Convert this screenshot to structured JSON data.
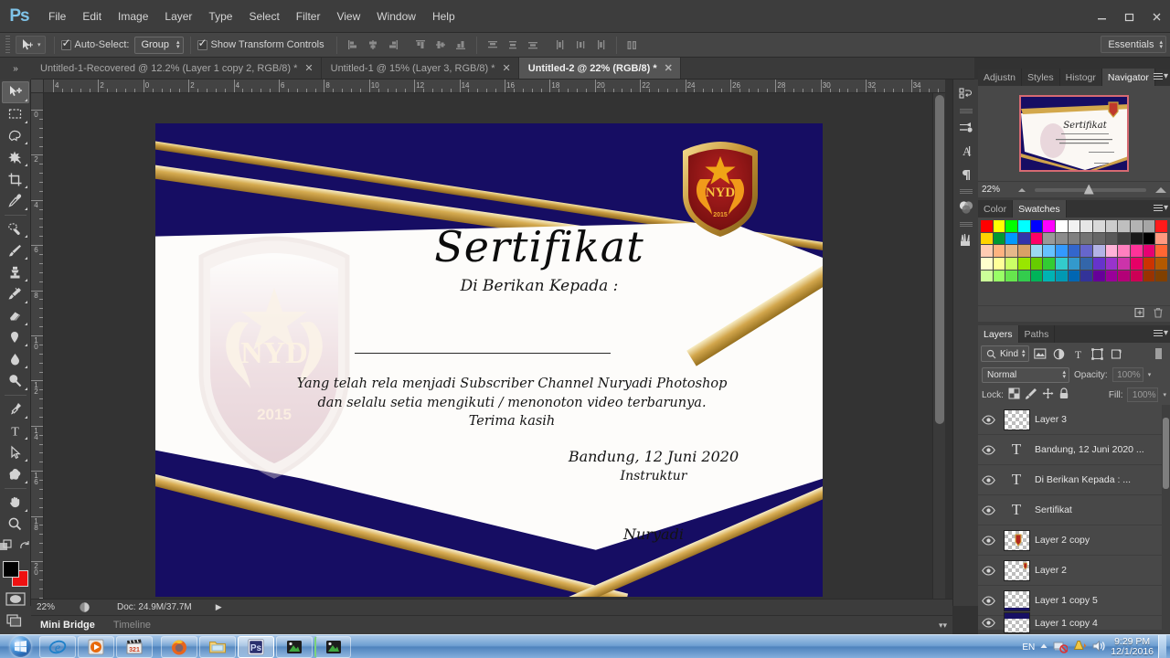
{
  "app": {
    "name": "Adobe Photoshop",
    "logo_text": "Ps"
  },
  "menubar": {
    "items": [
      "File",
      "Edit",
      "Image",
      "Layer",
      "Type",
      "Select",
      "Filter",
      "View",
      "Window",
      "Help"
    ],
    "window_controls": {
      "minimize": "—",
      "restore": "❐",
      "close": "✕"
    }
  },
  "options_bar": {
    "auto_select_label": "Auto-Select:",
    "auto_select_checked": true,
    "auto_select_value": "Group",
    "show_transform_label": "Show Transform Controls",
    "show_transform_checked": true,
    "workspace": "Essentials",
    "align_icons": [
      "align-left-edges",
      "align-horizontal-centers",
      "align-right-edges",
      "align-top-edges",
      "align-vertical-centers",
      "align-bottom-edges",
      "distribute-top-edges",
      "distribute-vertical-centers",
      "distribute-bottom-edges",
      "distribute-left-edges",
      "distribute-horizontal-centers",
      "distribute-right-edges",
      "auto-align-layers"
    ]
  },
  "tabs": [
    {
      "label": "Untitled-1-Recovered @ 12.2% (Layer 1 copy 2, RGB/8) *",
      "active": false
    },
    {
      "label": "Untitled-1 @ 15% (Layer 3, RGB/8) *",
      "active": false
    },
    {
      "label": "Untitled-2 @ 22% (RGB/8) *",
      "active": true
    }
  ],
  "toolbar": {
    "tools": [
      {
        "name": "move-tool",
        "selected": true
      },
      {
        "name": "rectangular-marquee-tool",
        "selected": false
      },
      {
        "name": "lasso-tool",
        "selected": false
      },
      {
        "name": "quick-selection-tool",
        "selected": false
      },
      {
        "name": "crop-tool",
        "selected": false
      },
      {
        "name": "eyedropper-tool",
        "selected": false
      },
      {
        "name": "spot-healing-brush-tool",
        "selected": false
      },
      {
        "name": "brush-tool",
        "selected": false
      },
      {
        "name": "clone-stamp-tool",
        "selected": false
      },
      {
        "name": "history-brush-tool",
        "selected": false
      },
      {
        "name": "eraser-tool",
        "selected": false
      },
      {
        "name": "gradient-tool",
        "selected": false
      },
      {
        "name": "blur-tool",
        "selected": false
      },
      {
        "name": "dodge-tool",
        "selected": false
      },
      {
        "name": "pen-tool",
        "selected": false
      },
      {
        "name": "horizontal-type-tool",
        "selected": false
      },
      {
        "name": "path-selection-tool",
        "selected": false
      },
      {
        "name": "custom-shape-tool",
        "selected": false
      },
      {
        "name": "hand-tool",
        "selected": false
      },
      {
        "name": "zoom-tool",
        "selected": false
      }
    ],
    "foreground_color": "#000000",
    "background_color": "#ee1111"
  },
  "rulers": {
    "unit": "inches",
    "horizontal_labels": [
      "4",
      "2",
      "0",
      "2",
      "4",
      "6",
      "8",
      "10",
      "12",
      "14",
      "16",
      "18",
      "20",
      "22",
      "24",
      "26",
      "28",
      "30",
      "32",
      "34"
    ],
    "vertical_labels": [
      "0",
      "2",
      "4",
      "6",
      "8",
      "10",
      "12",
      "14",
      "16",
      "18",
      "20"
    ]
  },
  "document": {
    "title": "Untitled-2",
    "zoom": "22%",
    "color_mode": "RGB/8",
    "certificate": {
      "title": "Sertifikat",
      "subtitle": "Di Berikan Kepada :",
      "body_lines": [
        "Yang telah rela menjadi Subscriber  Channel Nuryadi Photoshop",
        "dan selalu setia mengikuti  /  menonoton video terbarunya.",
        "Terima kasih"
      ],
      "place_date": "Bandung, 12 Juni 2020",
      "role": "Instruktur",
      "signature": "Nuryadi",
      "emblem_text": "NYD",
      "emblem_year": "2015",
      "navy_color": "#160d63",
      "gold_color": "#d4a84e",
      "paper_color": "#fdfcfa"
    }
  },
  "icon_dock": {
    "icons": [
      "history-icon",
      "tool-presets-icon",
      "character-icon",
      "paragraph-icon",
      "color-balance-icon",
      "brush-presets-icon"
    ]
  },
  "navigator_panel": {
    "tabs": [
      {
        "label": "Adjustn",
        "active": false
      },
      {
        "label": "Styles",
        "active": false
      },
      {
        "label": "Histogr",
        "active": false
      },
      {
        "label": "Navigator",
        "active": true
      }
    ],
    "zoom_value": "22%"
  },
  "color_panel": {
    "tabs": [
      {
        "label": "Color",
        "active": false
      },
      {
        "label": "Swatches",
        "active": true
      }
    ],
    "swatches": [
      "#ff0000",
      "#ffff00",
      "#00ff00",
      "#00ffff",
      "#0000ff",
      "#ff00ff",
      "#ffffff",
      "#f2f2f2",
      "#e6e6e6",
      "#d9d9d9",
      "#cccccc",
      "#bfbfbf",
      "#b3b3b3",
      "#a6a6a6",
      "#ff1a1a",
      "#ffd400",
      "#009933",
      "#0099ff",
      "#3333aa",
      "#ff0066",
      "#999999",
      "#8c8c8c",
      "#808080",
      "#737373",
      "#666666",
      "#595959",
      "#404040",
      "#1a1a1a",
      "#000000",
      "#ff9980",
      "#ffccb3",
      "#ffb380",
      "#e6b88a",
      "#d9a066",
      "#9cd9f0",
      "#66c2ff",
      "#3399ff",
      "#3366cc",
      "#6666cc",
      "#b3b3e6",
      "#ffb3d9",
      "#ff80bf",
      "#ff3399",
      "#e60073",
      "#ff6633",
      "#ffffcc",
      "#ffff99",
      "#ccff66",
      "#99e600",
      "#66cc00",
      "#33cc33",
      "#33cccc",
      "#3399cc",
      "#3366aa",
      "#6633cc",
      "#9933cc",
      "#cc33aa",
      "#e60066",
      "#cc3300",
      "#b35900",
      "#ccff99",
      "#99ff66",
      "#66e64d",
      "#33cc4d",
      "#00b359",
      "#00b3b3",
      "#0099b3",
      "#0066b3",
      "#333399",
      "#660099",
      "#990099",
      "#b30077",
      "#cc0055",
      "#993300",
      "#804000"
    ]
  },
  "layers_panel": {
    "tabs": [
      {
        "label": "Layers",
        "active": true
      },
      {
        "label": "Paths",
        "active": false
      }
    ],
    "filter_label": "Kind",
    "filter_icons": [
      "pixel-filter-icon",
      "adjustment-filter-icon",
      "type-filter-icon",
      "shape-filter-icon",
      "smart-object-filter-icon"
    ],
    "blend_mode": "Normal",
    "opacity_label": "Opacity:",
    "opacity_value": "100%",
    "lock_label": "Lock:",
    "fill_label": "Fill:",
    "fill_value": "100%",
    "lock_icons": [
      "lock-transparent-pixels-icon",
      "lock-image-pixels-icon",
      "lock-position-icon",
      "lock-all-icon"
    ],
    "layers": [
      {
        "name": "Layer 3",
        "type": "pixel",
        "visible": true
      },
      {
        "name": "Bandung, 12 Juni 2020 ...",
        "type": "text",
        "visible": true
      },
      {
        "name": "Di Berikan Kepada :     ...",
        "type": "text",
        "visible": true
      },
      {
        "name": "Sertifikat",
        "type": "text",
        "visible": true
      },
      {
        "name": "Layer 2 copy",
        "type": "pixel",
        "visible": true
      },
      {
        "name": "Layer 2",
        "type": "pixel",
        "visible": true
      },
      {
        "name": "Layer 1 copy 5",
        "type": "pixel",
        "visible": true
      },
      {
        "name": "Layer 1 copy 4",
        "type": "pixel",
        "visible": true
      }
    ],
    "footer_icons": [
      "link-layers-icon",
      "layer-style-fx-icon",
      "layer-mask-icon",
      "adjustment-layer-icon",
      "new-group-icon",
      "new-layer-icon",
      "delete-layer-icon"
    ]
  },
  "status_bar": {
    "zoom": "22%",
    "doc_label": "Doc: 24.9M/37.7M",
    "arrow": "▶"
  },
  "bottom_panel": {
    "tabs": [
      {
        "label": "Mini Bridge",
        "active": true
      },
      {
        "label": "Timeline",
        "active": false
      }
    ]
  },
  "taskbar": {
    "buttons": [
      {
        "name": "internet-explorer",
        "glyph": "e"
      },
      {
        "name": "windows-media-player",
        "glyph": "▶"
      },
      {
        "name": "video-editor",
        "glyph": "🎬"
      },
      {
        "name": "mozilla-firefox",
        "glyph": "🦊"
      },
      {
        "name": "windows-explorer",
        "glyph": "📁"
      },
      {
        "name": "adobe-photoshop",
        "glyph": "Ps"
      },
      {
        "name": "nvidia-app",
        "glyph": "◆"
      },
      {
        "name": "screen-recorder",
        "glyph": "◆"
      }
    ],
    "tray": {
      "language": "EN",
      "time": "9:29 PM",
      "date": "12/1/2016",
      "icons": [
        "network-icon",
        "action-center-icon",
        "volume-icon"
      ]
    }
  }
}
